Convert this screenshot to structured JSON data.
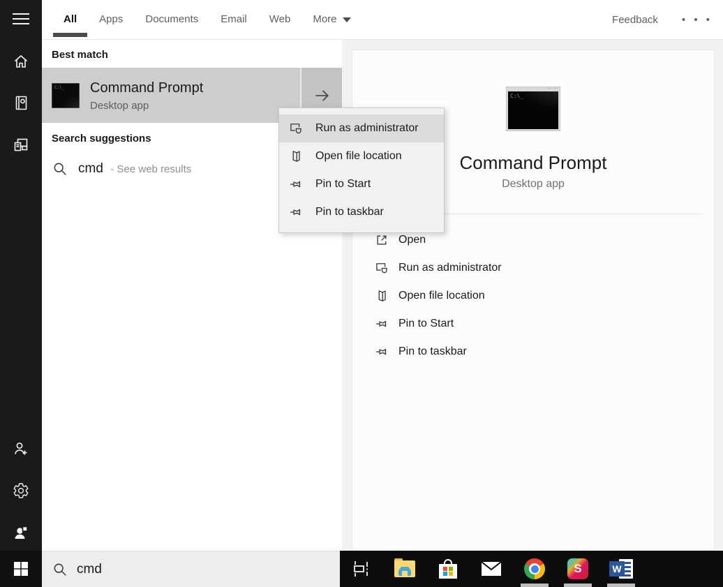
{
  "tabbar": {
    "tabs": [
      {
        "label": "All",
        "active": true
      },
      {
        "label": "Apps",
        "active": false
      },
      {
        "label": "Documents",
        "active": false
      },
      {
        "label": "Email",
        "active": false
      },
      {
        "label": "Web",
        "active": false
      },
      {
        "label": "More",
        "active": false
      }
    ],
    "feedback_label": "Feedback",
    "overflow": "• • •"
  },
  "sidebar": {
    "icons": [
      "menu",
      "home",
      "journal",
      "devices",
      "add-account",
      "settings",
      "feedback-hub",
      "start"
    ]
  },
  "best_match": {
    "header": "Best match",
    "app": {
      "title": "Command Prompt",
      "subtitle": "Desktop app"
    }
  },
  "suggestions": {
    "header": "Search suggestions",
    "query": "cmd",
    "hint": "- See web results"
  },
  "context_menu": {
    "highlighted": "Run as administrator",
    "items": [
      {
        "label": "Run as administrator"
      },
      {
        "label": "Open file location"
      },
      {
        "label": "Pin to Start"
      },
      {
        "label": "Pin to taskbar"
      }
    ]
  },
  "preview": {
    "title": "Command Prompt",
    "subtitle": "Desktop app",
    "icon_text": "C:\\_",
    "actions": [
      {
        "label": "Open"
      },
      {
        "label": "Run as administrator"
      },
      {
        "label": "Open file location"
      },
      {
        "label": "Pin to Start"
      },
      {
        "label": "Pin to taskbar"
      }
    ]
  },
  "search_box": {
    "value": "cmd"
  },
  "taskbar": {
    "apps": [
      "task-view",
      "file-explorer",
      "store",
      "mail",
      "chrome",
      "slack",
      "word"
    ],
    "running": [
      "chrome",
      "slack",
      "word"
    ],
    "slack_letter": "S",
    "word_letter": "W"
  },
  "colors": {
    "rail_bg": "#1a1a1a",
    "taskbar_bg": "#0d0d0d",
    "selected_row": "#cdcdcd",
    "menu_bg": "#f1f1f1",
    "menu_highlight": "#dcdcdc",
    "active_tab_underline": "#4a4a4a",
    "right_region_bg": "#f2f2f2"
  }
}
